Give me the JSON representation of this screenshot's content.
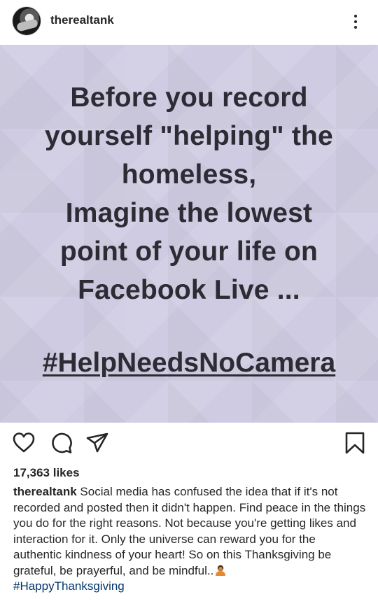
{
  "header": {
    "username": "therealtank",
    "avatar_icon": "profile-avatar",
    "more_icon": "more-vertical-icon"
  },
  "post": {
    "lines": [
      "Before you record",
      "yourself \"helping\" the",
      "homeless,",
      "Imagine the lowest",
      "point of your life  on",
      "Facebook Live ..."
    ],
    "hashtag": "#HelpNeedsNoCamera",
    "background_color": "#cfcbe2",
    "text_color": "#2d2b34"
  },
  "actions": {
    "like_icon": "heart-icon",
    "comment_icon": "comment-icon",
    "share_icon": "send-icon",
    "save_icon": "bookmark-icon"
  },
  "likes": "17,363 likes",
  "caption": {
    "username": "therealtank",
    "text": " Social media has confused the idea that if it's not recorded and posted then it didn't happen. Find peace in the things you do for the right reasons. Not because you're getting likes and interaction for it.  Only the universe can reward you for the authentic kindness of your heart! So on this Thanksgiving be grateful, be prayerful, and be mindful..",
    "emoji": "person-bowing-emoji",
    "hashtag": "#HappyThanksgiving",
    "hashtag_color": "#003569"
  }
}
